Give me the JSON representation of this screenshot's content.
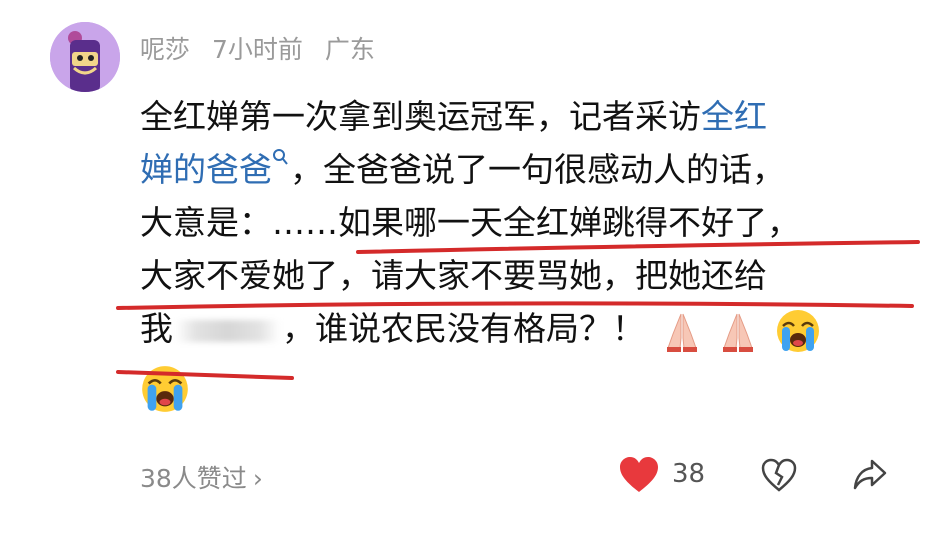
{
  "comment": {
    "author": "呢莎",
    "time": "7小时前",
    "location": "广东",
    "lines": {
      "l1_text": "全红婵第一次拿到奥运冠军，记者采访",
      "l1_link": "全红",
      "l2_link": "婵的爸爸",
      "l2_text": "，全爸爸说了一句很感动人的话，",
      "l3_text": "大意是：……如果哪一天全红婵跳得不好了，",
      "l4_text": "大家不爱她了，请大家不要骂她，把她还给",
      "l5_start": "我",
      "l5_end": "，谁说农民没有格局？！"
    },
    "emojis": [
      "praying-hands",
      "praying-hands",
      "loudly-crying-face",
      "loudly-crying-face"
    ]
  },
  "footer": {
    "likes_text": "38人赞过",
    "chevron": "›",
    "like_count": "38"
  },
  "colors": {
    "link": "#2f6db3",
    "heart": "#e8393d",
    "underline": "#d42a2a",
    "meta": "#9a9a9a"
  },
  "icons": [
    "search-icon",
    "heart-icon",
    "broken-heart-icon",
    "share-icon",
    "chevron-right-icon"
  ]
}
